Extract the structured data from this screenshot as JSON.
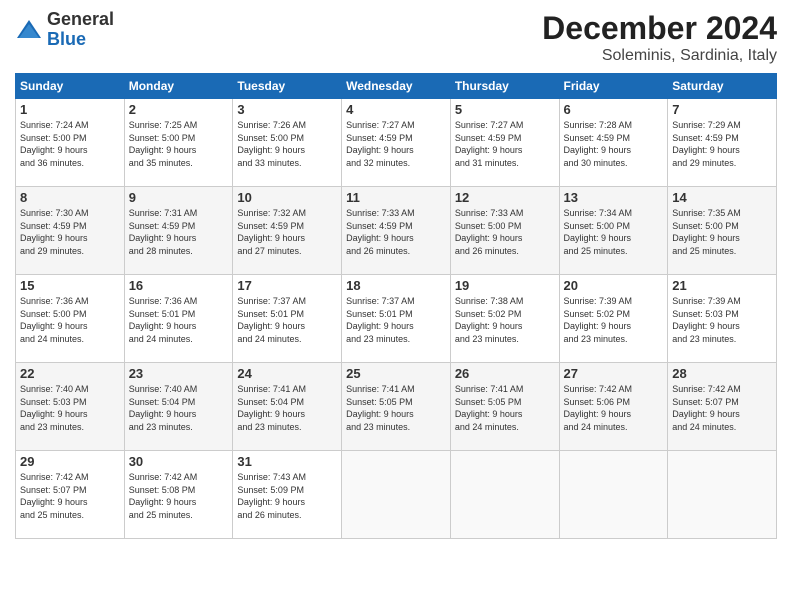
{
  "logo": {
    "general": "General",
    "blue": "Blue"
  },
  "header": {
    "month": "December 2024",
    "location": "Soleminis, Sardinia, Italy"
  },
  "weekdays": [
    "Sunday",
    "Monday",
    "Tuesday",
    "Wednesday",
    "Thursday",
    "Friday",
    "Saturday"
  ],
  "weeks": [
    [
      {
        "day": 1,
        "info": "Sunrise: 7:24 AM\nSunset: 5:00 PM\nDaylight: 9 hours\nand 36 minutes."
      },
      {
        "day": 2,
        "info": "Sunrise: 7:25 AM\nSunset: 5:00 PM\nDaylight: 9 hours\nand 35 minutes."
      },
      {
        "day": 3,
        "info": "Sunrise: 7:26 AM\nSunset: 5:00 PM\nDaylight: 9 hours\nand 33 minutes."
      },
      {
        "day": 4,
        "info": "Sunrise: 7:27 AM\nSunset: 4:59 PM\nDaylight: 9 hours\nand 32 minutes."
      },
      {
        "day": 5,
        "info": "Sunrise: 7:27 AM\nSunset: 4:59 PM\nDaylight: 9 hours\nand 31 minutes."
      },
      {
        "day": 6,
        "info": "Sunrise: 7:28 AM\nSunset: 4:59 PM\nDaylight: 9 hours\nand 30 minutes."
      },
      {
        "day": 7,
        "info": "Sunrise: 7:29 AM\nSunset: 4:59 PM\nDaylight: 9 hours\nand 29 minutes."
      }
    ],
    [
      {
        "day": 8,
        "info": "Sunrise: 7:30 AM\nSunset: 4:59 PM\nDaylight: 9 hours\nand 29 minutes."
      },
      {
        "day": 9,
        "info": "Sunrise: 7:31 AM\nSunset: 4:59 PM\nDaylight: 9 hours\nand 28 minutes."
      },
      {
        "day": 10,
        "info": "Sunrise: 7:32 AM\nSunset: 4:59 PM\nDaylight: 9 hours\nand 27 minutes."
      },
      {
        "day": 11,
        "info": "Sunrise: 7:33 AM\nSunset: 4:59 PM\nDaylight: 9 hours\nand 26 minutes."
      },
      {
        "day": 12,
        "info": "Sunrise: 7:33 AM\nSunset: 5:00 PM\nDaylight: 9 hours\nand 26 minutes."
      },
      {
        "day": 13,
        "info": "Sunrise: 7:34 AM\nSunset: 5:00 PM\nDaylight: 9 hours\nand 25 minutes."
      },
      {
        "day": 14,
        "info": "Sunrise: 7:35 AM\nSunset: 5:00 PM\nDaylight: 9 hours\nand 25 minutes."
      }
    ],
    [
      {
        "day": 15,
        "info": "Sunrise: 7:36 AM\nSunset: 5:00 PM\nDaylight: 9 hours\nand 24 minutes."
      },
      {
        "day": 16,
        "info": "Sunrise: 7:36 AM\nSunset: 5:01 PM\nDaylight: 9 hours\nand 24 minutes."
      },
      {
        "day": 17,
        "info": "Sunrise: 7:37 AM\nSunset: 5:01 PM\nDaylight: 9 hours\nand 24 minutes."
      },
      {
        "day": 18,
        "info": "Sunrise: 7:37 AM\nSunset: 5:01 PM\nDaylight: 9 hours\nand 23 minutes."
      },
      {
        "day": 19,
        "info": "Sunrise: 7:38 AM\nSunset: 5:02 PM\nDaylight: 9 hours\nand 23 minutes."
      },
      {
        "day": 20,
        "info": "Sunrise: 7:39 AM\nSunset: 5:02 PM\nDaylight: 9 hours\nand 23 minutes."
      },
      {
        "day": 21,
        "info": "Sunrise: 7:39 AM\nSunset: 5:03 PM\nDaylight: 9 hours\nand 23 minutes."
      }
    ],
    [
      {
        "day": 22,
        "info": "Sunrise: 7:40 AM\nSunset: 5:03 PM\nDaylight: 9 hours\nand 23 minutes."
      },
      {
        "day": 23,
        "info": "Sunrise: 7:40 AM\nSunset: 5:04 PM\nDaylight: 9 hours\nand 23 minutes."
      },
      {
        "day": 24,
        "info": "Sunrise: 7:41 AM\nSunset: 5:04 PM\nDaylight: 9 hours\nand 23 minutes."
      },
      {
        "day": 25,
        "info": "Sunrise: 7:41 AM\nSunset: 5:05 PM\nDaylight: 9 hours\nand 23 minutes."
      },
      {
        "day": 26,
        "info": "Sunrise: 7:41 AM\nSunset: 5:05 PM\nDaylight: 9 hours\nand 24 minutes."
      },
      {
        "day": 27,
        "info": "Sunrise: 7:42 AM\nSunset: 5:06 PM\nDaylight: 9 hours\nand 24 minutes."
      },
      {
        "day": 28,
        "info": "Sunrise: 7:42 AM\nSunset: 5:07 PM\nDaylight: 9 hours\nand 24 minutes."
      }
    ],
    [
      {
        "day": 29,
        "info": "Sunrise: 7:42 AM\nSunset: 5:07 PM\nDaylight: 9 hours\nand 25 minutes."
      },
      {
        "day": 30,
        "info": "Sunrise: 7:42 AM\nSunset: 5:08 PM\nDaylight: 9 hours\nand 25 minutes."
      },
      {
        "day": 31,
        "info": "Sunrise: 7:43 AM\nSunset: 5:09 PM\nDaylight: 9 hours\nand 26 minutes."
      },
      null,
      null,
      null,
      null
    ]
  ]
}
